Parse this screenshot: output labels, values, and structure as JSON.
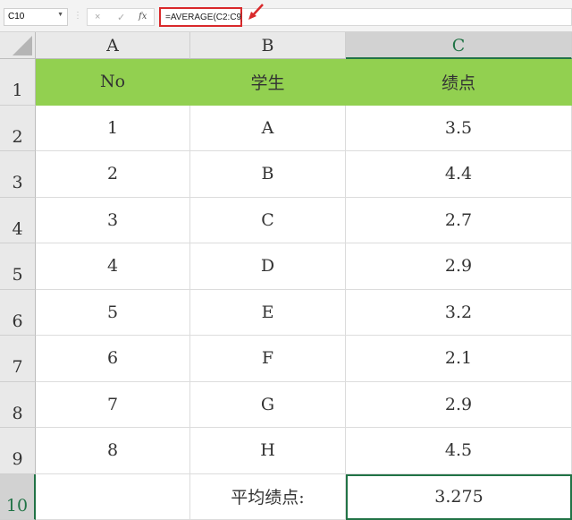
{
  "toolbar": {
    "name_box": "C10",
    "cancel_icon": "×",
    "enter_icon": "✓",
    "fx_icon": "fx",
    "formula": "=AVERAGE(C2:C9)"
  },
  "columns": [
    "A",
    "B",
    "C"
  ],
  "rows": [
    "1",
    "2",
    "3",
    "4",
    "5",
    "6",
    "7",
    "8",
    "9",
    "10"
  ],
  "header": [
    "No",
    "学生",
    "绩点"
  ],
  "data": [
    [
      "1",
      "A",
      "3.5"
    ],
    [
      "2",
      "B",
      "4.4"
    ],
    [
      "3",
      "C",
      "2.7"
    ],
    [
      "4",
      "D",
      "2.9"
    ],
    [
      "5",
      "E",
      "3.2"
    ],
    [
      "6",
      "F",
      "2.1"
    ],
    [
      "7",
      "G",
      "2.9"
    ],
    [
      "8",
      "H",
      "4.5"
    ]
  ],
  "summary": {
    "label": "平均绩点:",
    "value": "3.275"
  },
  "colors": {
    "header_fill": "#92d050",
    "highlight": "#d9292b",
    "selection": "#217346"
  }
}
